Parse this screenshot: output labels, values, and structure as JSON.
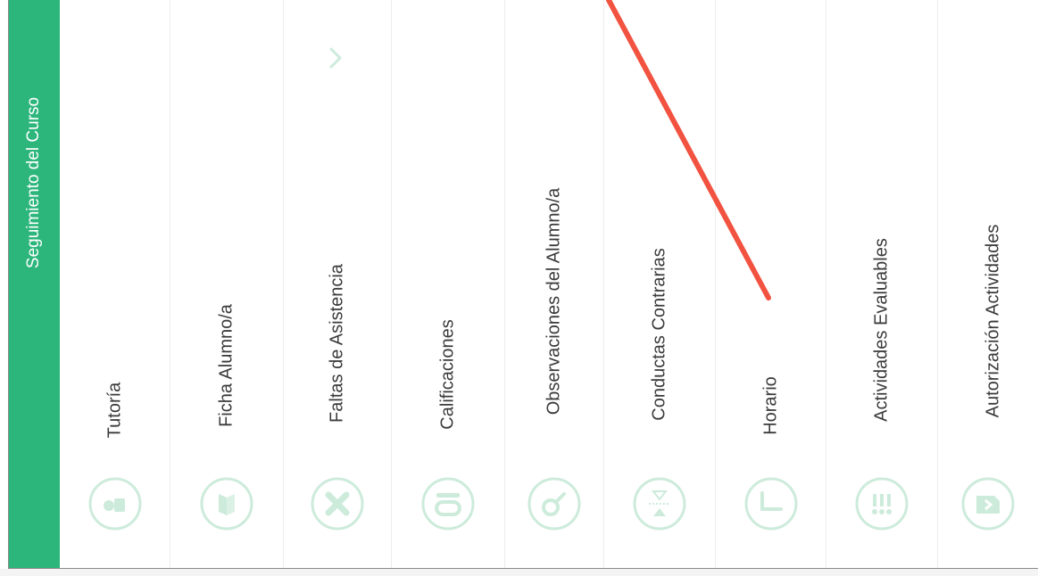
{
  "header": {
    "title": "Seguimiento del Curso"
  },
  "menu": {
    "items": [
      {
        "label": "Tutoría",
        "icon": "tutoria-icon"
      },
      {
        "label": "Ficha Alumno/a",
        "icon": "ficha-icon"
      },
      {
        "label": "Faltas de Asistencia",
        "icon": "close-x-icon"
      },
      {
        "label": "Calificaciones",
        "icon": "grade-10-icon"
      },
      {
        "label": "Observaciones del Alumno/a",
        "icon": "magnifier-icon"
      },
      {
        "label": "Conductas Contrarias",
        "icon": "hourglass-icon"
      },
      {
        "label": "Horario",
        "icon": "clock-icon"
      },
      {
        "label": "Actividades Evaluables",
        "icon": "exclamation-icon"
      },
      {
        "label": "Autorización Actividades",
        "icon": "document-icon"
      }
    ]
  },
  "colors": {
    "accent": "#2db67c",
    "icon": "#cdebdb",
    "annotation": "#f25240"
  }
}
